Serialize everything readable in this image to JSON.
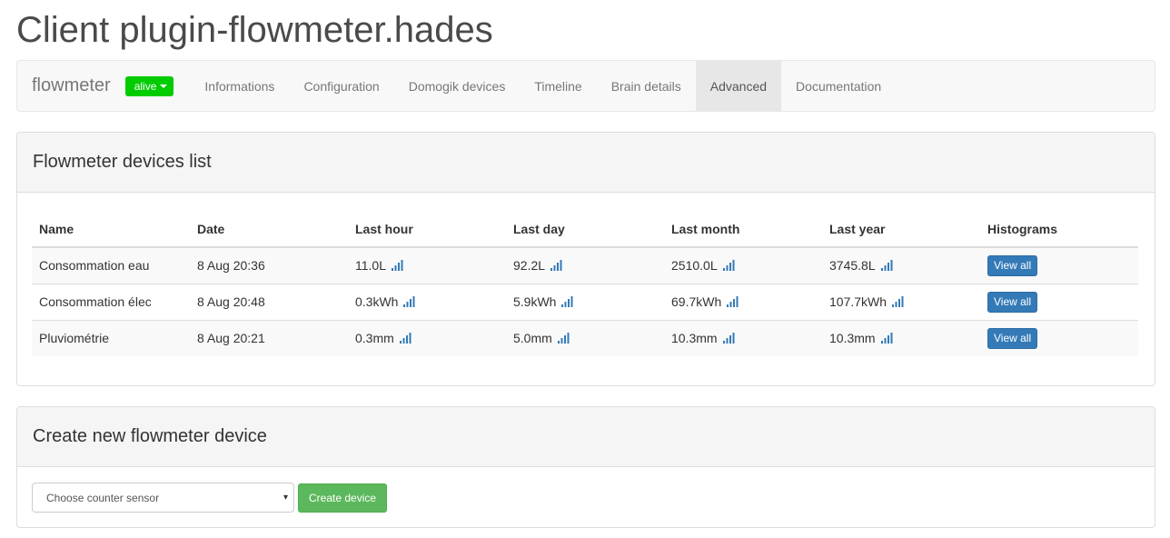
{
  "page": {
    "title": "Client plugin-flowmeter.hades"
  },
  "navbar": {
    "brand": "flowmeter",
    "status": "alive",
    "items": [
      {
        "label": "Informations",
        "active": false
      },
      {
        "label": "Configuration",
        "active": false
      },
      {
        "label": "Domogik devices",
        "active": false
      },
      {
        "label": "Timeline",
        "active": false
      },
      {
        "label": "Brain details",
        "active": false
      },
      {
        "label": "Advanced",
        "active": true
      },
      {
        "label": "Documentation",
        "active": false
      }
    ]
  },
  "devices_panel": {
    "title": "Flowmeter devices list",
    "columns": [
      "Name",
      "Date",
      "Last hour",
      "Last day",
      "Last month",
      "Last year",
      "Histograms"
    ],
    "rows": [
      {
        "name": "Consommation eau",
        "date": "8 Aug 20:36",
        "last_hour": "11.0L",
        "last_day": "92.2L",
        "last_month": "2510.0L",
        "last_year": "3745.8L",
        "action": "View all"
      },
      {
        "name": "Consommation élec",
        "date": "8 Aug 20:48",
        "last_hour": "0.3kWh",
        "last_day": "5.9kWh",
        "last_month": "69.7kWh",
        "last_year": "107.7kWh",
        "action": "View all"
      },
      {
        "name": "Pluviométrie",
        "date": "8 Aug 20:21",
        "last_hour": "0.3mm",
        "last_day": "5.0mm",
        "last_month": "10.3mm",
        "last_year": "10.3mm",
        "action": "View all"
      }
    ]
  },
  "create_panel": {
    "title": "Create new flowmeter device",
    "select_value": "Choose counter sensor",
    "button": "Create device"
  },
  "icons": {
    "chart": "signal-bars-icon",
    "dropdown": "caret-down-icon"
  },
  "colors": {
    "status": "#00cc00",
    "primary": "#337ab7",
    "success": "#5cb85c",
    "icon": "#337ab7"
  }
}
